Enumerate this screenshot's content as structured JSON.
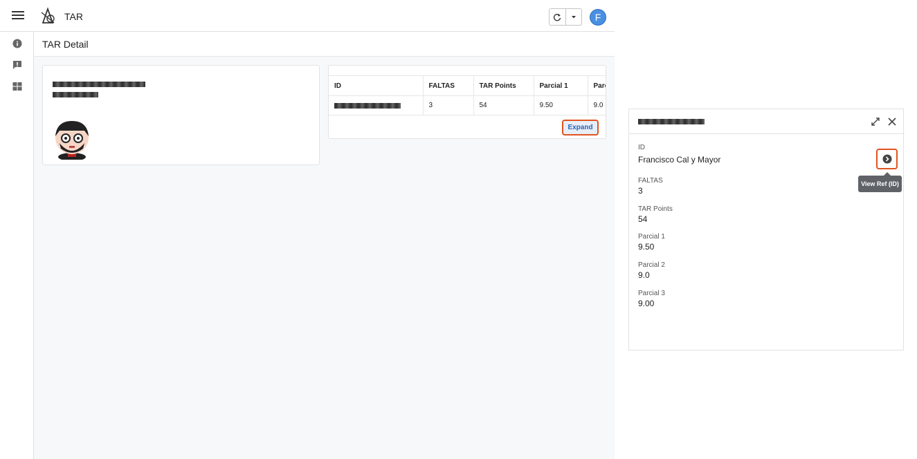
{
  "header": {
    "app_title": "TAR",
    "avatar_letter": "F"
  },
  "page": {
    "title": "TAR Detail"
  },
  "table": {
    "columns": [
      "ID",
      "FALTAS",
      "TAR Points",
      "Parcial 1",
      "Parc"
    ],
    "row": {
      "faltas": "3",
      "tar_points": "54",
      "parcial1": "9.50",
      "parcial2": "9.0"
    },
    "expand_label": "Expand"
  },
  "detail": {
    "fields": [
      {
        "label": "ID",
        "value": "Francisco Cal y Mayor"
      },
      {
        "label": "FALTAS",
        "value": "3"
      },
      {
        "label": "TAR Points",
        "value": "54"
      },
      {
        "label": "Parcial 1",
        "value": "9.50"
      },
      {
        "label": "Parcial 2",
        "value": "9.0"
      },
      {
        "label": "Parcial 3",
        "value": "9.00"
      }
    ],
    "tooltip": "View Ref (ID)"
  },
  "colors": {
    "accent_border": "#e0531f",
    "avatar_bg": "#4a90e2",
    "button_text": "#2d63b6"
  }
}
